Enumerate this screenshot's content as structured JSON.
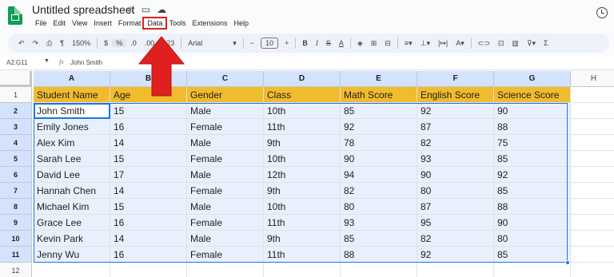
{
  "header": {
    "doc_title": "Untitled spreadsheet",
    "menus": [
      "File",
      "Edit",
      "View",
      "Insert",
      "Format",
      "Data",
      "Tools",
      "Extensions",
      "Help"
    ],
    "active_menu_index": 5
  },
  "toolbar": {
    "zoom": "150%",
    "currency": "$",
    "percent": "%",
    "decrease_decimal": ".0",
    "increase_decimal": ".00",
    "number_format": "123",
    "font": "Arial",
    "font_size": "10",
    "bold": "B",
    "italic": "I",
    "strike": "S",
    "text_color": "A",
    "sigma": "Σ"
  },
  "formula_bar": {
    "range": "A2:G11",
    "fx": "fx",
    "value": "John Smith"
  },
  "sheet": {
    "columns": [
      "A",
      "B",
      "C",
      "D",
      "E",
      "F",
      "G",
      "H"
    ],
    "row_numbers": [
      "1",
      "2",
      "3",
      "4",
      "5",
      "6",
      "7",
      "8",
      "9",
      "10",
      "11",
      "12"
    ],
    "headers": [
      "Student Name",
      "Age",
      "Gender",
      "Class",
      "Math Score",
      "English Score",
      "Science Score"
    ],
    "rows": [
      [
        "John Smith",
        "15",
        "Male",
        "10th",
        "85",
        "92",
        "90"
      ],
      [
        "Emily Jones",
        "16",
        "Female",
        "11th",
        "92",
        "87",
        "88"
      ],
      [
        "Alex Kim",
        "14",
        "Male",
        "9th",
        "78",
        "82",
        "75"
      ],
      [
        "Sarah Lee",
        "15",
        "Female",
        "10th",
        "90",
        "93",
        "85"
      ],
      [
        "David Lee",
        "17",
        "Male",
        "12th",
        "94",
        "90",
        "92"
      ],
      [
        "Hannah Chen",
        "14",
        "Female",
        "9th",
        "82",
        "80",
        "85"
      ],
      [
        "Michael Kim",
        "15",
        "Male",
        "10th",
        "80",
        "87",
        "88"
      ],
      [
        "Grace Lee",
        "16",
        "Female",
        "11th",
        "93",
        "95",
        "90"
      ],
      [
        "Kevin Park",
        "14",
        "Male",
        "9th",
        "85",
        "82",
        "80"
      ],
      [
        "Jenny Wu",
        "16",
        "Female",
        "11th",
        "88",
        "92",
        "85"
      ]
    ]
  },
  "colors": {
    "header_fill": "#f0bc2d",
    "selection_fill": "#e8f0fe",
    "selection_border": "#1a73e8",
    "annotation_red": "#e02020"
  }
}
